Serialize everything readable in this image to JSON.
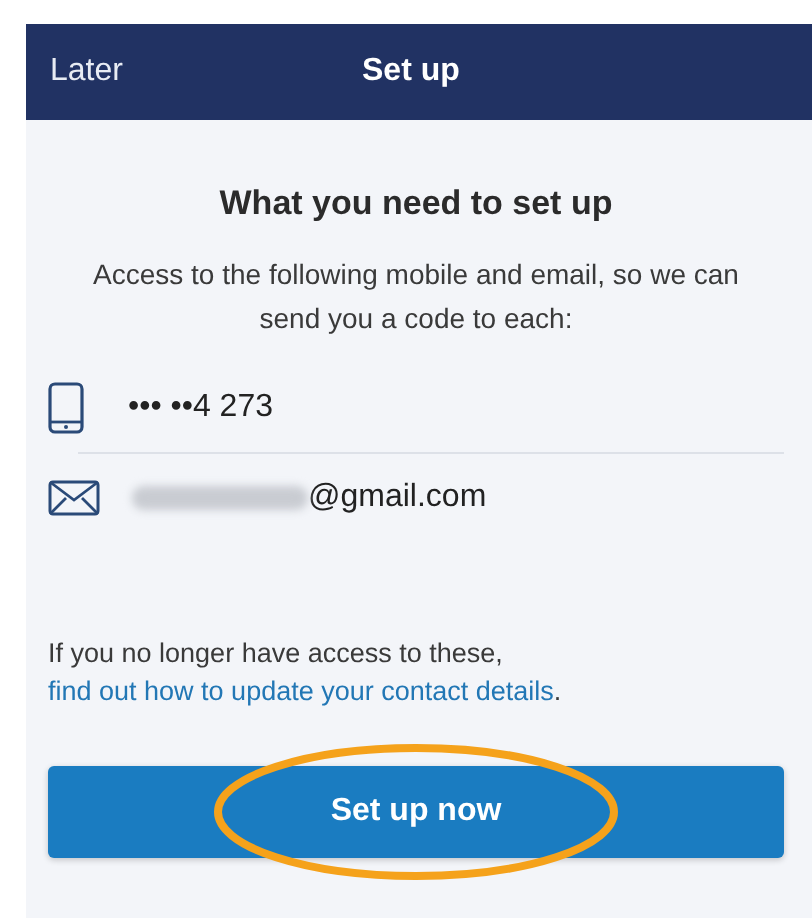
{
  "header": {
    "left_action": "Later",
    "title": "Set up"
  },
  "heading": "What you need to set up",
  "description": "Access to the following mobile and email, so we can send you a code to each:",
  "contacts": [
    {
      "kind": "phone",
      "value": "••• ••4 273",
      "redacted": false
    },
    {
      "kind": "email",
      "value": "@gmail.com",
      "redacted": true
    }
  ],
  "notice": {
    "text": "If you no longer have access to these, ",
    "link": "find out how to update your contact details",
    "end": "."
  },
  "button": {
    "label": "Set up now",
    "circled": true
  }
}
